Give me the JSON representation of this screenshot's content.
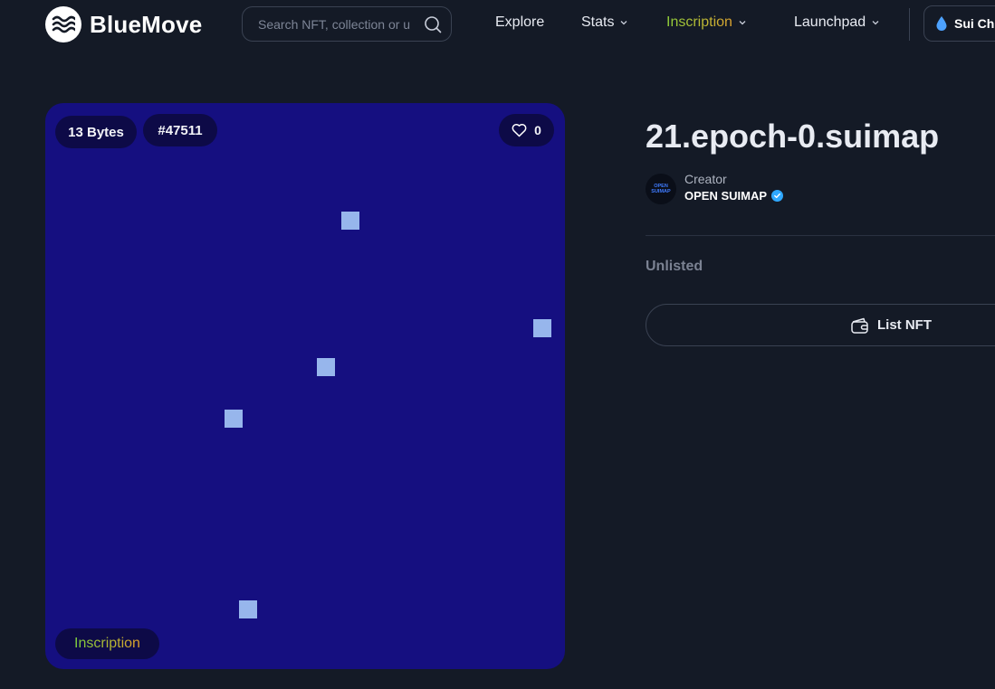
{
  "header": {
    "brand": "BlueMove",
    "search_placeholder": "Search NFT, collection or u",
    "nav": {
      "explore": "Explore",
      "stats": "Stats",
      "inscription": "Inscription",
      "launchpad": "Launchpad"
    },
    "chain_label": "Sui Ch"
  },
  "nft": {
    "size_badge": "13 Bytes",
    "id_badge": "#47511",
    "likes": "0",
    "type_badge": "Inscription",
    "title": "21.epoch-0.suimap",
    "creator_label": "Creator",
    "creator_name": "OPEN SUIMAP",
    "creator_avatar_text": [
      "OPEN",
      "SUIMAP"
    ],
    "status": "Unlisted",
    "list_button": "List NFT"
  },
  "icons": {
    "logo": "bluemove-wave-logo",
    "search": "search-icon",
    "chevron": "chevron-down-icon",
    "chain": "sui-drop-icon",
    "like": "heart-icon",
    "verified": "verified-check-icon",
    "wallet": "wallet-icon"
  },
  "colors": {
    "background": "#141a26",
    "card": "#150f80",
    "pixel": "#97b6ec",
    "accent_green": "#7ccf3e",
    "accent_orange": "#e0a02c",
    "verified": "#2fa8ff"
  }
}
